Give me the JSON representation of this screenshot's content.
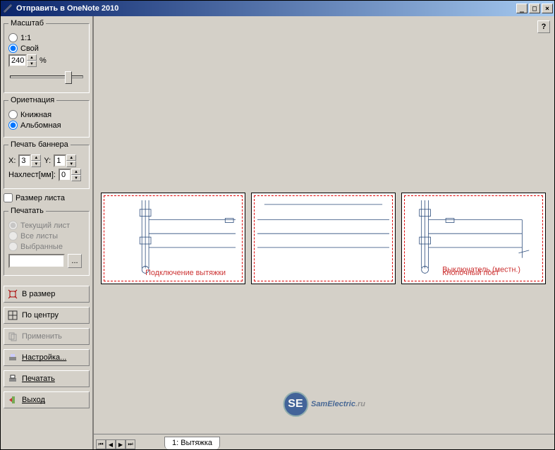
{
  "window": {
    "title": "Отправить в OneNote 2010"
  },
  "scale": {
    "legend": "Масштаб",
    "opt_11": "1:1",
    "opt_custom": "Свой",
    "value": "240",
    "percent": "%"
  },
  "orientation": {
    "legend": "Ориетнация",
    "portrait": "Книжная",
    "landscape": "Альбомная"
  },
  "banner": {
    "legend": "Печать баннера",
    "x_label": "X:",
    "x_value": "3",
    "y_label": "Y:",
    "y_value": "1",
    "overlap_label": "Нахлест[мм]:",
    "overlap_value": "0"
  },
  "page_size_check": "Размер листа",
  "print": {
    "legend": "Печатать",
    "current": "Текущий лист",
    "all": "Все листы",
    "selected": "Выбранные"
  },
  "buttons": {
    "fit": "В размер",
    "center": "По центру",
    "apply": "Применить",
    "settings": "Настройка...",
    "print": "Печатать",
    "exit": "Выход"
  },
  "tab": {
    "label": "1: Вытяжка"
  },
  "help": "?",
  "watermark": {
    "brand": "SamElectric",
    "tld": ".ru",
    "badge": "SE"
  }
}
